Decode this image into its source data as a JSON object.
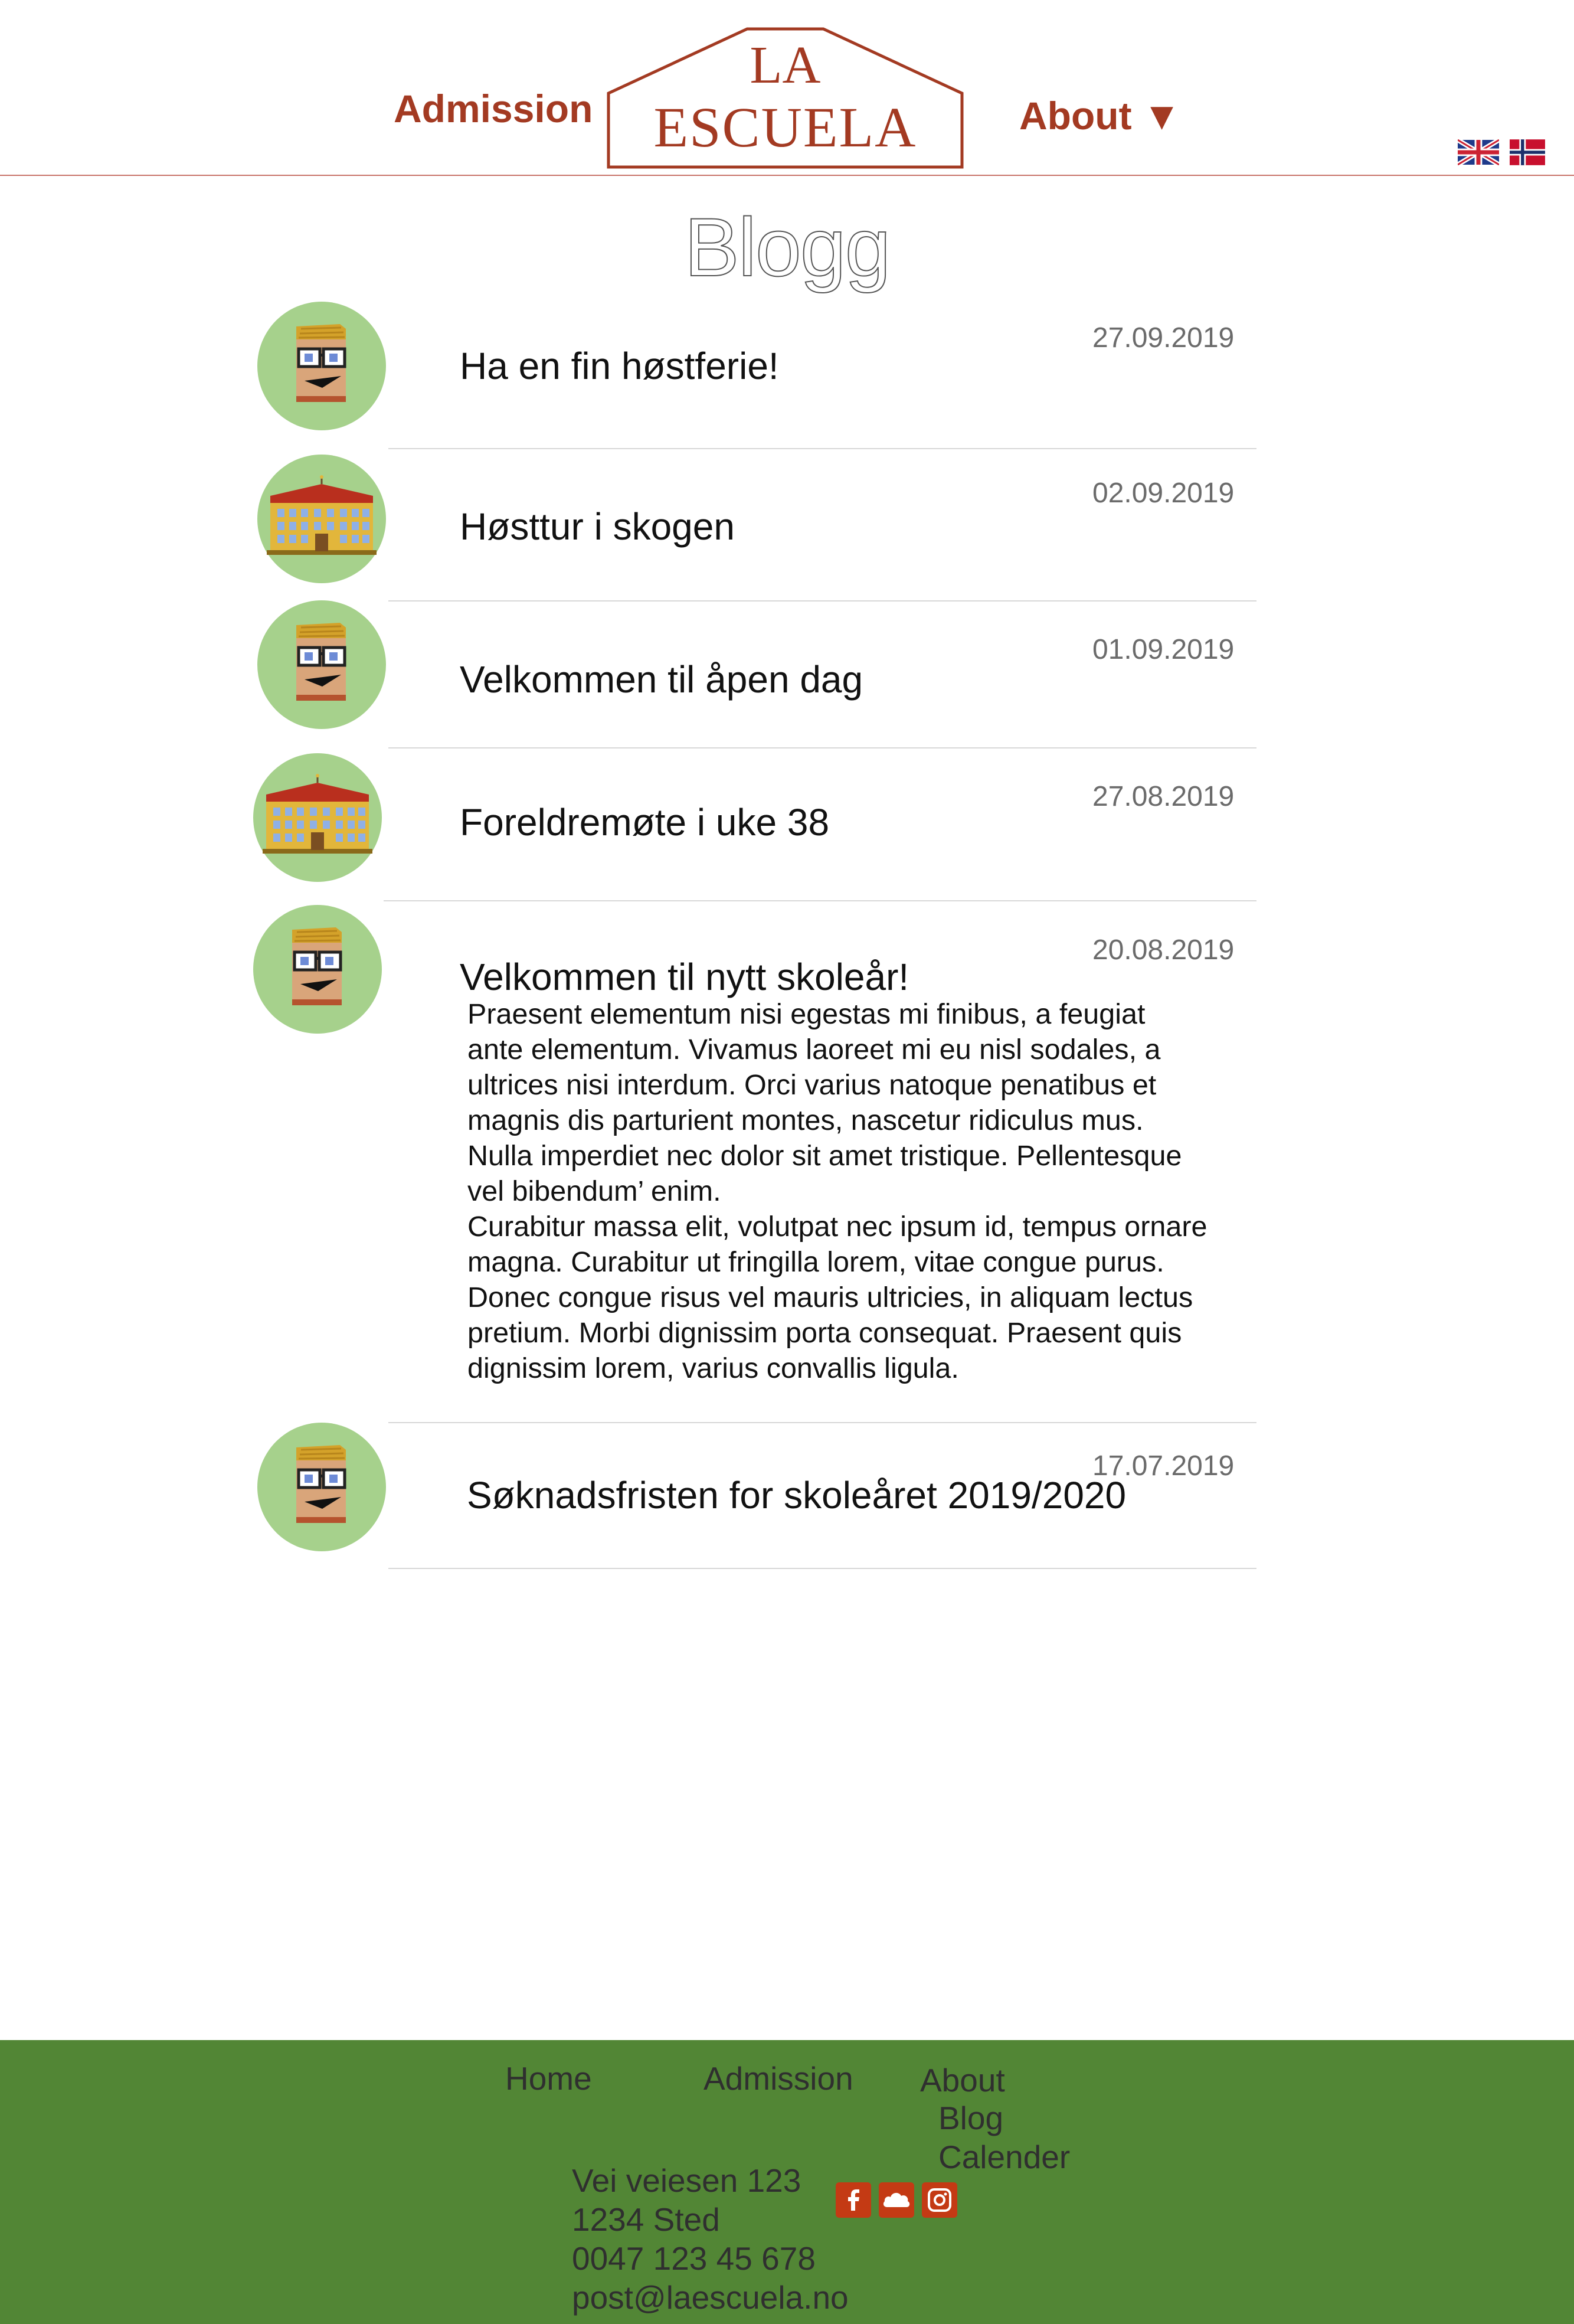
{
  "header": {
    "nav_admission": "Admission",
    "nav_about": "About ▼",
    "logo_line1": "LA",
    "logo_line2": "ESCUELA",
    "flags": [
      "english-flag-icon",
      "norwegian-flag-icon"
    ]
  },
  "page_title": "Blogg",
  "posts": [
    {
      "title": "Ha en fin høstferie!",
      "date": "27.09.2019",
      "avatar": "teacher-avatar-icon"
    },
    {
      "title": "Høsttur i skogen",
      "date": "02.09.2019",
      "avatar": "school-building-icon"
    },
    {
      "title": "Velkommen til åpen dag",
      "date": "01.09.2019",
      "avatar": "teacher-avatar-icon"
    },
    {
      "title": "Foreldremøte i uke 38",
      "date": "27.08.2019",
      "avatar": "school-building-icon"
    },
    {
      "title": "Velkommen til nytt skoleår!",
      "date": "20.08.2019",
      "avatar": "teacher-avatar-icon",
      "body_lines": [
        "Praesent elementum nisi egestas mi finibus, a feugiat",
        "ante elementum. Vivamus laoreet mi eu nisl sodales, a",
        "ultrices nisi interdum. Orci varius natoque penatibus et",
        "magnis dis parturient montes, nascetur ridiculus mus.",
        "Nulla imperdiet nec dolor sit amet tristique. Pellentesque",
        "vel bibendum’ enim.",
        "Curabitur massa elit, volutpat nec ipsum id, tempus ornare",
        "magna. Curabitur ut fringilla lorem, vitae congue purus.",
        "Donec congue risus vel mauris ultricies, in aliquam lectus",
        "pretium. Morbi dignissim porta consequat. Praesent quis",
        "dignissim lorem, varius convallis ligula."
      ]
    },
    {
      "title": "Søknadsfristen for skoleåret 2019/2020",
      "date": "17.07.2019",
      "avatar": "teacher-avatar-icon"
    }
  ],
  "footer": {
    "links": {
      "home": "Home",
      "admission": "Admission",
      "about": "About",
      "blog": "Blog",
      "calender": "Calender"
    },
    "address": [
      "Vei veiesen 123",
      "1234 Sted",
      "0047 123 45 678",
      "post@laescuela.no"
    ],
    "social": [
      "facebook-icon",
      "cloud-icon",
      "instagram-icon"
    ]
  },
  "colors": {
    "brand": "#a33a22",
    "avatar_bg": "#a6d18c",
    "footer_bg": "#528635",
    "social_bg": "#c43a14",
    "text_muted": "#6b6b6b"
  }
}
